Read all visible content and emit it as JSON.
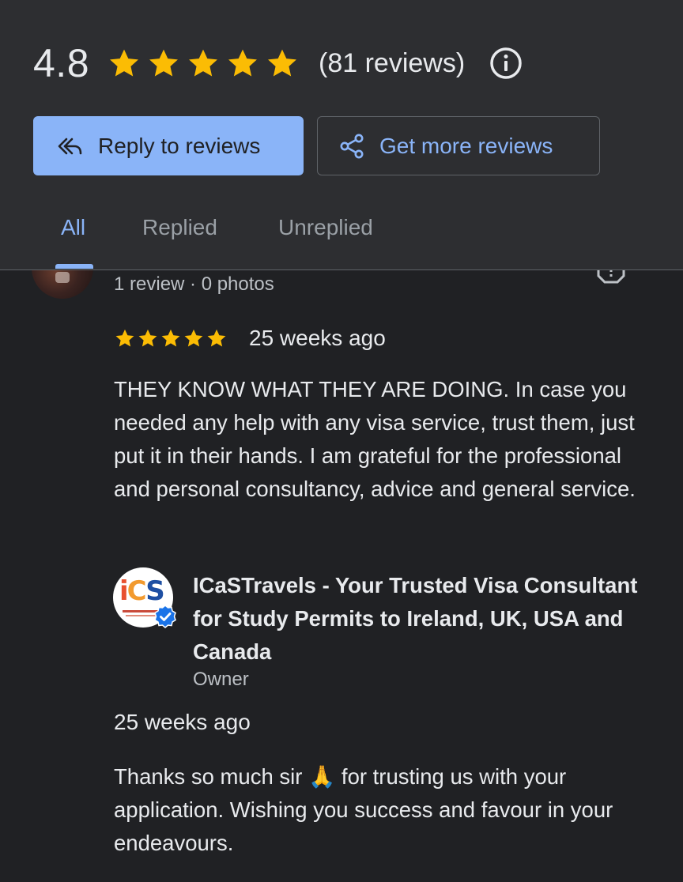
{
  "summary": {
    "rating": "4.8",
    "stars_filled": 5,
    "review_count_text": "(81 reviews)",
    "star_color": "#fbbc04"
  },
  "actions": {
    "reply_label": "Reply to reviews",
    "more_label": "Get more reviews"
  },
  "tabs": [
    {
      "label": "All",
      "active": true
    },
    {
      "label": "Replied",
      "active": false
    },
    {
      "label": "Unreplied",
      "active": false
    }
  ],
  "review": {
    "meta": "1 review · 0 photos",
    "stars": 5,
    "date": "25 weeks ago",
    "text": "THEY KNOW WHAT THEY ARE DOING. In case you needed any help with any visa service, trust them, just put it in their hands. I am grateful for the professional and personal consultancy, advice and general service."
  },
  "owner_reply": {
    "logo_text": "iCS",
    "name": "ICaSTravels - Your Trusted Visa Consultant for Study Permits to Ireland, UK, USA and Canada",
    "role": "Owner",
    "date": "25 weeks ago",
    "text": "Thanks so much sir 🙏 for trusting us with your application. Wishing you success and favour in your endeavours."
  },
  "colors": {
    "accent": "#8ab4f8",
    "background": "#202124",
    "header_background": "#2d2e31"
  }
}
